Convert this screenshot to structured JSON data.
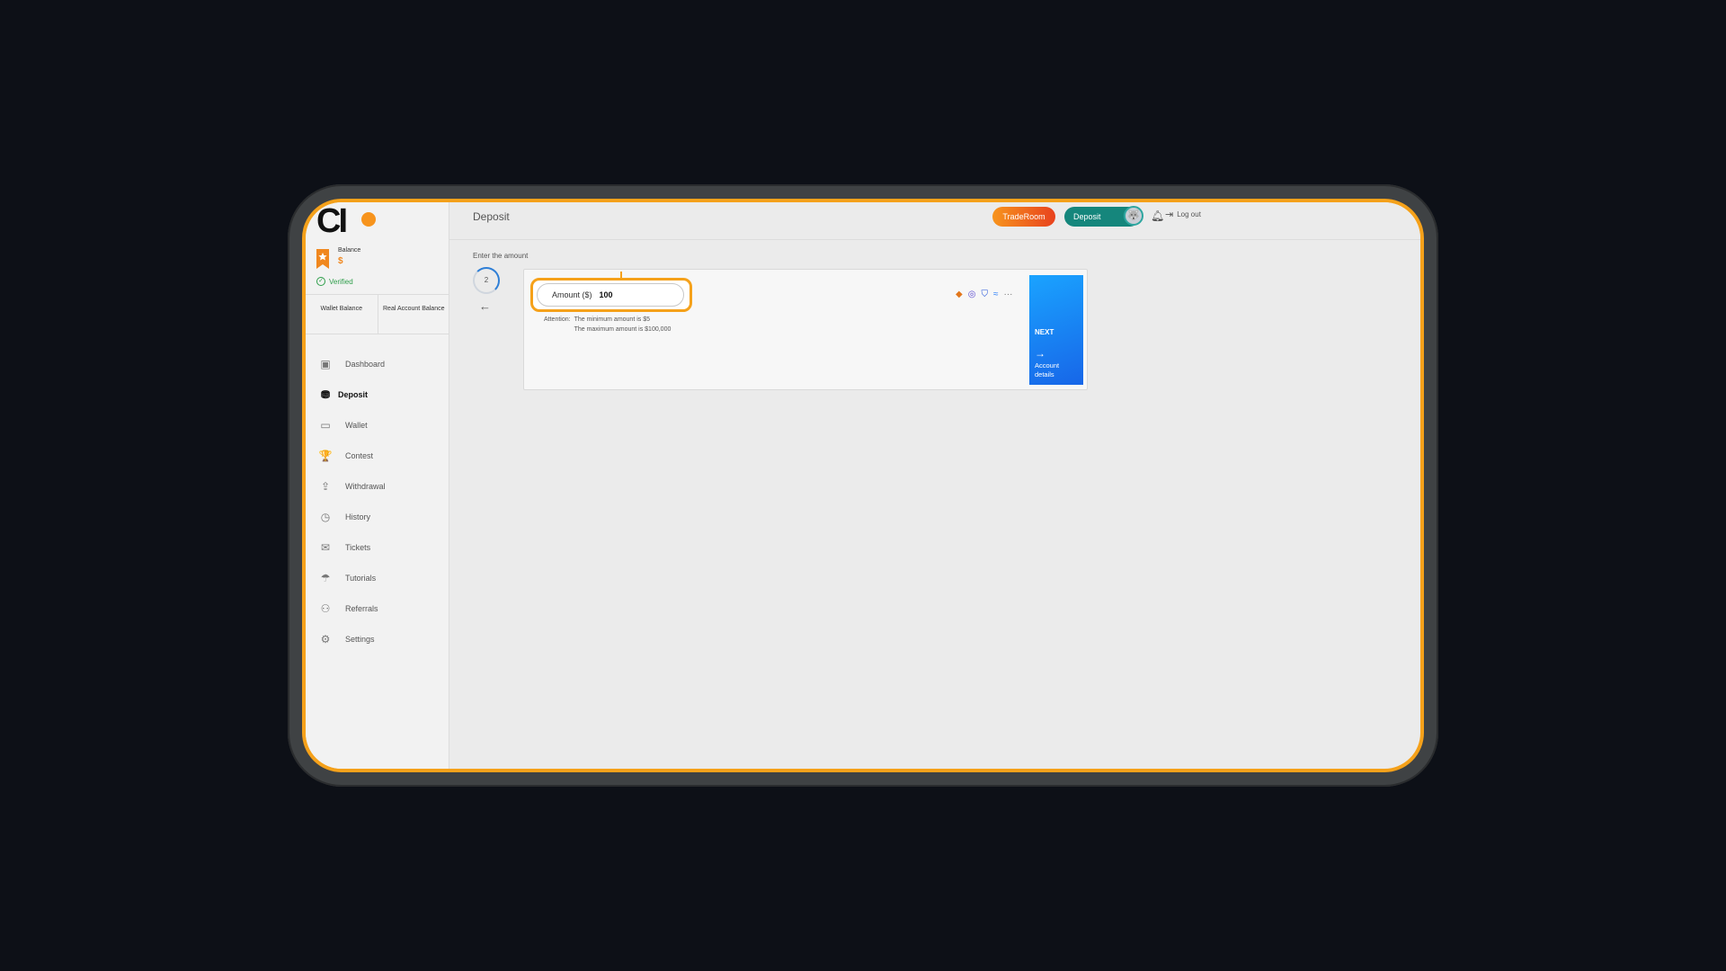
{
  "app": {
    "page_title": "Deposit"
  },
  "sidebar": {
    "balance_label": "Balance",
    "balance_value": "$",
    "verified_label": "Verified",
    "balance_tabs": [
      "Wallet Balance",
      "Real Account Balance"
    ],
    "items": [
      {
        "label": "Dashboard",
        "icon": "dashboard-icon",
        "glyph": "▣"
      },
      {
        "label": "Deposit",
        "icon": "deposit-icon",
        "glyph": "⛃"
      },
      {
        "label": "Wallet",
        "icon": "wallet-icon",
        "glyph": "▭"
      },
      {
        "label": "Contest",
        "icon": "trophy-icon",
        "glyph": "🏆"
      },
      {
        "label": "Withdrawal",
        "icon": "withdrawal-icon",
        "glyph": "⇪"
      },
      {
        "label": "History",
        "icon": "history-icon",
        "glyph": "◷"
      },
      {
        "label": "Tickets",
        "icon": "tickets-icon",
        "glyph": "✉"
      },
      {
        "label": "Tutorials",
        "icon": "tutorials-icon",
        "glyph": "☂"
      },
      {
        "label": "Referrals",
        "icon": "referrals-icon",
        "glyph": "⚇"
      },
      {
        "label": "Settings",
        "icon": "settings-icon",
        "glyph": "⚙"
      }
    ],
    "active_index": 1
  },
  "header": {
    "traderoom_label": "TradeRoom",
    "deposit_label": "Deposit",
    "logout_label": "Log out"
  },
  "main": {
    "enter_label": "Enter the amount",
    "step_number": "2",
    "amount_label": "Amount ($)",
    "amount_value": "100",
    "attention_label": "Attention:",
    "attention_lines": [
      "The minimum amount is $5",
      "The maximum amount is $100,000"
    ],
    "payment_icons": [
      "metamask-icon",
      "wallet-connect-icon",
      "shield-wallet-icon",
      "coinbase-icon"
    ],
    "more_label": "···",
    "next_label": "NEXT",
    "next_sub": "Account details"
  },
  "colors": {
    "accent": "#f5a11a",
    "teal": "#15867c",
    "blue": "#1a8cff"
  }
}
